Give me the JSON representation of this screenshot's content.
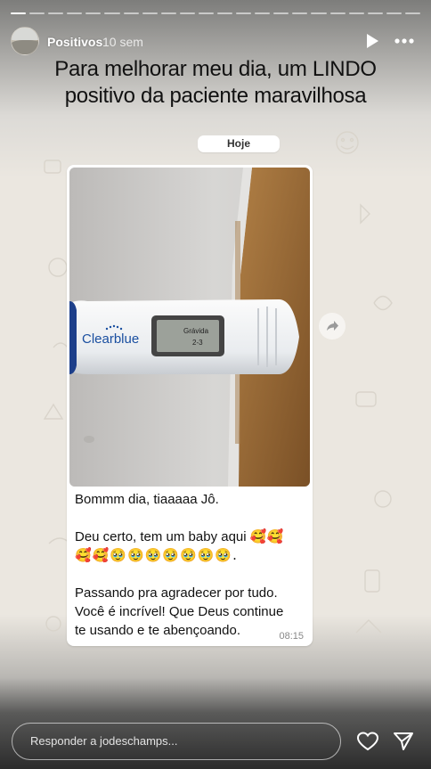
{
  "story": {
    "segment_count": 22,
    "active_segment": 1
  },
  "header": {
    "username": "Positivos",
    "time_ago": "10 sem",
    "play_icon": "play-icon",
    "more_icon": "more-options-icon"
  },
  "caption": {
    "line1": "Para melhorar meu dia, um LINDO",
    "line2": "positivo da paciente maravilhosa"
  },
  "chat": {
    "date_label": "Hoje",
    "photo": {
      "brand": "Clearblue",
      "display_text": "Grávida",
      "display_weeks": "2-3"
    },
    "message": {
      "line1": "Bommm dia, tiaaaaa Jô.",
      "line2": "Deu certo, tem um baby aqui 🥰🥰",
      "line3": "🥰🥰🥹🥹🥹🥹🥹🥹🥹.",
      "line4": "Passando pra agradecer por tudo.",
      "line5": "Você é incrível! Que Deus continue",
      "line6": "te usando e te abençoando."
    },
    "time": "08:15",
    "share_icon": "forward-icon"
  },
  "footer": {
    "reply_placeholder": "Responder a jodeschamps...",
    "heart_icon": "heart-icon",
    "send_icon": "send-icon"
  },
  "colors": {
    "chat_background": "#ebe7e0",
    "bubble": "#ffffff",
    "brand_blue": "#1a4fa0"
  }
}
